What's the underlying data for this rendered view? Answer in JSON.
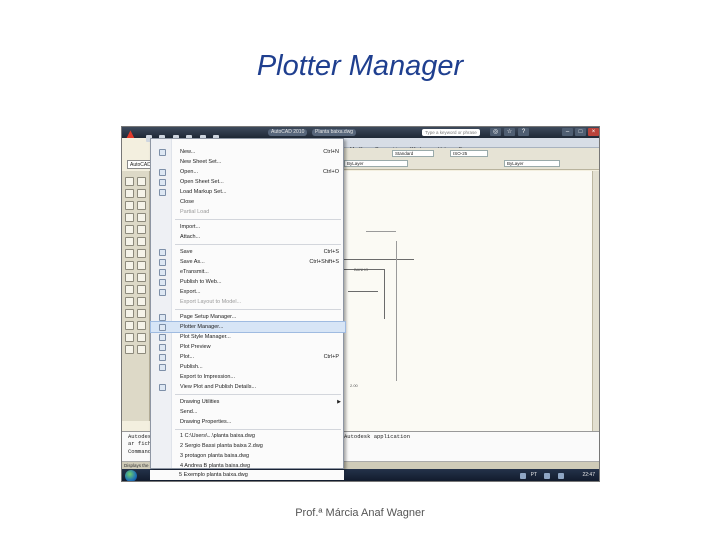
{
  "slide": {
    "title": "Plotter Manager",
    "footer": "Prof.ª Márcia Anaf Wagner"
  },
  "titlebar": {
    "app_name": "AutoCAD 2010",
    "file_name": "Planta baixa.dwg",
    "search_placeholder": "Type a keyword or phrase"
  },
  "workspace": "AutoCAD Cl",
  "ribbon_tabs": [
    "Modify",
    "Parametric",
    "Window",
    "Help",
    "Express"
  ],
  "properties": {
    "text_style": "Standard",
    "dim_style": "ISO-25",
    "layer_color": "ByLayer",
    "linetype": "ByLayer"
  },
  "drawing_labels": {
    "room": "BANHO",
    "dimension": "2.00"
  },
  "command_line": {
    "left_line1": "Autodesk",
    "left_line2": "ar fichei",
    "left_prompt": "Command:",
    "right_line": "Autodesk application"
  },
  "status_text": "Displays the Pl",
  "taskbar": {
    "lang": "PT",
    "time": "22:47"
  },
  "menu": {
    "items": [
      {
        "label": "New...",
        "shortcut": "Ctrl+N"
      },
      {
        "label": "New Sheet Set...",
        "shortcut": ""
      },
      {
        "label": "Open...",
        "shortcut": "Ctrl+O"
      },
      {
        "label": "Open Sheet Set...",
        "shortcut": ""
      },
      {
        "label": "Load Markup Set...",
        "shortcut": ""
      },
      {
        "label": "Close",
        "shortcut": ""
      },
      {
        "label": "Partial Load",
        "shortcut": ""
      },
      {
        "label": "Import...",
        "shortcut": ""
      },
      {
        "label": "Attach...",
        "shortcut": ""
      },
      {
        "label": "Save",
        "shortcut": "Ctrl+S"
      },
      {
        "label": "Save As...",
        "shortcut": "Ctrl+Shift+S"
      },
      {
        "label": "eTransmit...",
        "shortcut": ""
      },
      {
        "label": "Publish to Web...",
        "shortcut": ""
      },
      {
        "label": "Export...",
        "shortcut": ""
      },
      {
        "label": "Export Layout to Model...",
        "shortcut": ""
      },
      {
        "label": "Page Setup Manager...",
        "shortcut": ""
      },
      {
        "label": "Plotter Manager...",
        "shortcut": ""
      },
      {
        "label": "Plot Style Manager...",
        "shortcut": ""
      },
      {
        "label": "Plot Preview",
        "shortcut": ""
      },
      {
        "label": "Plot...",
        "shortcut": "Ctrl+P"
      },
      {
        "label": "Publish...",
        "shortcut": ""
      },
      {
        "label": "Export to Impression...",
        "shortcut": ""
      },
      {
        "label": "View Plot and Publish Details...",
        "shortcut": ""
      },
      {
        "label": "Drawing Utilities",
        "shortcut": ""
      },
      {
        "label": "Send...",
        "shortcut": ""
      },
      {
        "label": "Drawing Properties...",
        "shortcut": ""
      },
      {
        "label": "1 C:\\Users\\...\\planta baixa.dwg",
        "shortcut": ""
      },
      {
        "label": "2 Sergio Bassi planta baixa 2.dwg",
        "shortcut": ""
      },
      {
        "label": "3 protagon planta baixa.dwg",
        "shortcut": ""
      },
      {
        "label": "4 Andrea B planta baixa.dwg",
        "shortcut": ""
      },
      {
        "label": "5 Exemplo planta baixa.dwg",
        "shortcut": ""
      }
    ]
  },
  "colors": {
    "title": "#1f3f8f",
    "menu_highlight": "#d7e5f6",
    "app_logo": "#e13a2a"
  }
}
